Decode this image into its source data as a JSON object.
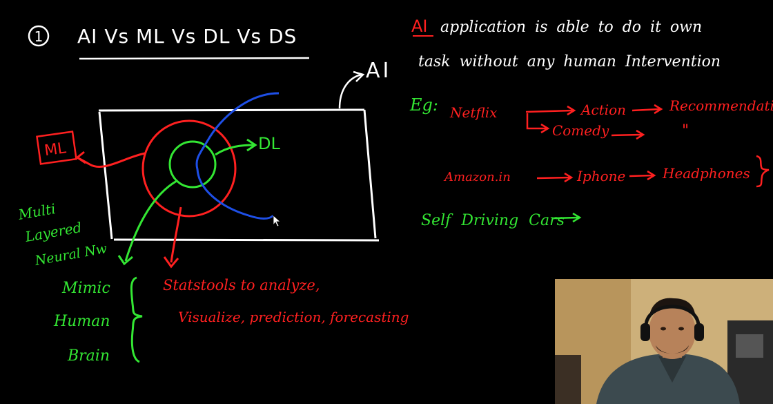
{
  "colors": {
    "white": "#ffffff",
    "red": "#ff2020",
    "green": "#33e633",
    "blue": "#1e4fe6",
    "board": "#000000"
  },
  "heading": {
    "number": "1",
    "title": "AI Vs ML Vs DL Vs DS"
  },
  "diagram": {
    "ai_label": "AI",
    "ml_label": "ML",
    "dl_label": "DL",
    "dl_note": [
      "Multi",
      "Layered",
      "Neural Nw"
    ],
    "brain_note": [
      "Mimic",
      "Human",
      "Brain"
    ],
    "ds_note": [
      "Statstools to analyze,",
      "Visualize, prediction, forecasting"
    ]
  },
  "notes": {
    "ai_prefix": "AI",
    "ai_definition_line1": "application is able to do it own",
    "ai_definition_line2": "task without any human Intervention",
    "eg_label": "Eg:",
    "netflix": "Netflix",
    "action": "Action",
    "recommendation": "Recommendation",
    "ditto": "\"",
    "comedy": "Comedy",
    "amazon": "Amazon.in",
    "iphone": "Iphone",
    "headphones": "Headphones",
    "self_driving": "Self Driving Cars"
  },
  "webcam": {
    "icons": [
      "presenter-icon",
      "headphones-icon"
    ]
  }
}
